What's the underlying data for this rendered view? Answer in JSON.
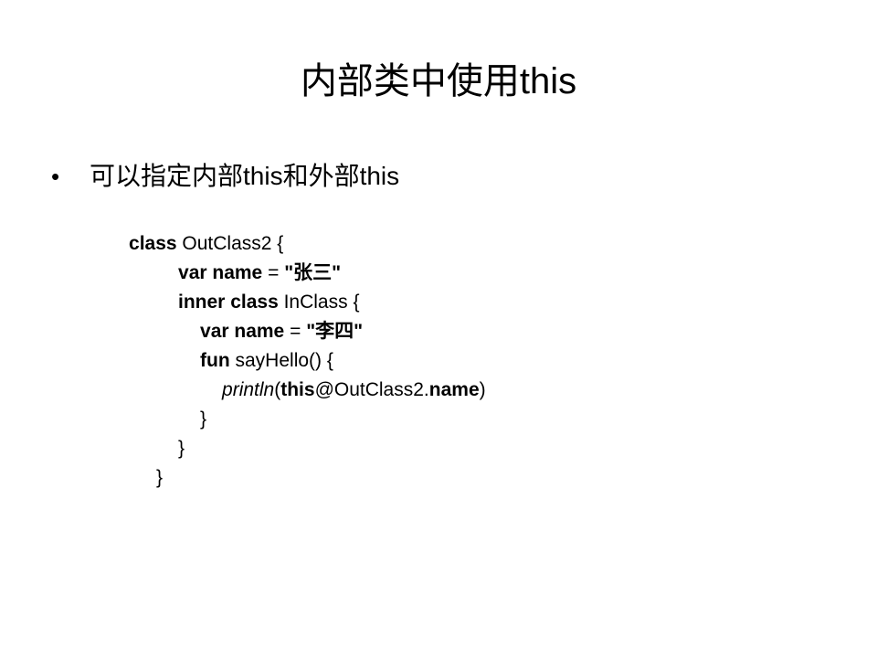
{
  "slide": {
    "title": "内部类中使用this",
    "bullet": {
      "symbol": "•",
      "text": "可以指定内部this和外部this"
    }
  },
  "code": {
    "l1": {
      "kw": "class",
      "rest": " OutClass2 {"
    },
    "l2": {
      "kw": "var name",
      "eq": " = ",
      "str": "\"张三\""
    },
    "l3": {
      "kw": "inner class",
      "rest": " InClass {"
    },
    "l4": {
      "kw": "var name",
      "eq": " = ",
      "str": "\"李四\""
    },
    "l5": {
      "kw": "fun",
      "rest": " sayHello() {"
    },
    "l6": {
      "fn": "println",
      "open": "(",
      "this_kw": "this",
      "label": "@OutClass2.",
      "prop": "name",
      "close": ")"
    },
    "l7": {
      "brace": "}"
    },
    "l8": {
      "brace": "}"
    },
    "l9": {
      "brace": "}"
    }
  }
}
